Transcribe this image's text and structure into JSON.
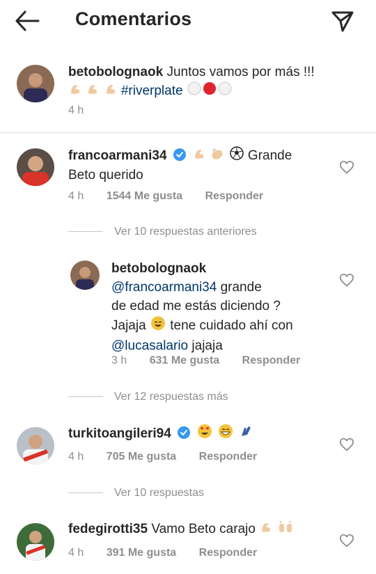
{
  "header": {
    "title": "Comentarios"
  },
  "caption": {
    "username": "betobolognaok",
    "text": "Juntos vamos por más !!!",
    "hashtag": "#riverplate",
    "time": "4 h"
  },
  "comments": [
    {
      "username": "francoarmani34",
      "text_line1_suffix": "Grande",
      "text_line2": "Beto querido",
      "time": "4 h",
      "likes": "1544 Me gusta",
      "reply": "Responder",
      "view_more": "Ver 10 respuestas anteriores"
    },
    {
      "username": "turkitoangileri94",
      "time": "4 h",
      "likes": "705 Me gusta",
      "reply": "Responder",
      "view_more": "Ver 10 respuestas"
    },
    {
      "username": "fedegirotti35",
      "text": "Vamo Beto carajo",
      "time": "4 h",
      "likes": "391 Me gusta",
      "reply": "Responder"
    }
  ],
  "reply": {
    "username": "betobolognaok",
    "mention1": "@francoarmani34",
    "text1": "grande",
    "text2": "de edad me estás diciendo ?",
    "text3a": "Jajaja",
    "text3b": "tene cuidado ahí con",
    "mention2": "@lucasalario",
    "text4": "jajaja",
    "time": "3 h",
    "likes": "631 Me gusta",
    "reply": "Responder"
  },
  "reply_view_more": "Ver 12 respuestas más",
  "colors": {
    "link": "#00376b",
    "muted": "#8e8e8e",
    "verified": "#3897f0"
  }
}
